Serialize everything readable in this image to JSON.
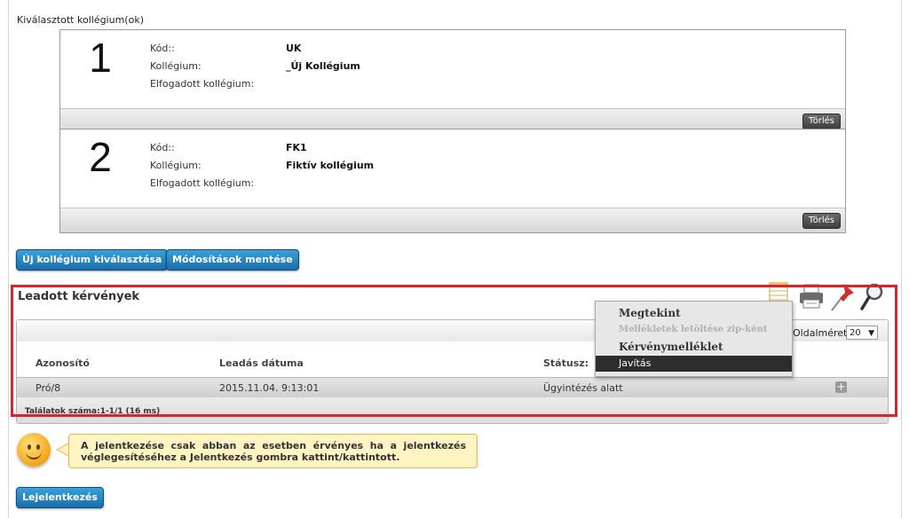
{
  "selected_section": {
    "title": "Kiválasztott kollégium(ok)"
  },
  "colleges": [
    {
      "number": "1",
      "code_label": "Kód::",
      "code": "UK",
      "college_label": "Kollégium:",
      "college": "_Új Kollégium",
      "accepted_label": "Elfogadott kollégium:",
      "accepted": "",
      "delete_label": "Törlés"
    },
    {
      "number": "2",
      "code_label": "Kód::",
      "code": "FK1",
      "college_label": "Kollégium:",
      "college": "Fiktív kollégium",
      "accepted_label": "Elfogadott kollégium:",
      "accepted": "",
      "delete_label": "Törlés"
    }
  ],
  "actions": {
    "new_college": "Új kollégium kiválasztása",
    "save_changes": "Módosítások mentése"
  },
  "requests": {
    "title": "Leadott kérvények",
    "page_size_label": "Oldalméret",
    "page_size_value": "20",
    "columns": {
      "id": "Azonosító",
      "date": "Leadás dátuma",
      "status": "Státusz:"
    },
    "rows": [
      {
        "id": "Pró/8",
        "date": "2015.11.04. 9:13:01",
        "status": "Ügyintézés alatt"
      }
    ],
    "summary": "Találatok száma:1-1/1 (16 ms)",
    "toolbar_icons": [
      "table-icon",
      "print-icon",
      "pin-icon",
      "search-icon"
    ]
  },
  "context_menu": {
    "items": [
      {
        "label": "Megtekint",
        "state": "normal"
      },
      {
        "label": "Mellékletek letöltése zip-ként",
        "state": "disabled"
      },
      {
        "label": "Kérvénymelléklet",
        "state": "normal"
      },
      {
        "label": "Javítás",
        "state": "active"
      }
    ]
  },
  "notice": {
    "text": "A jelentkezése csak abban az esetben érvényes ha a jelentkezés véglegesítéséhez a Jelentkezés gombra kattint/kattintott."
  },
  "submit": {
    "label": "Lejelentkezés"
  },
  "colors": {
    "accent_blue": "#1a6ea8",
    "highlight_red": "#d9232d",
    "notice_bg": "#fff4c2"
  }
}
